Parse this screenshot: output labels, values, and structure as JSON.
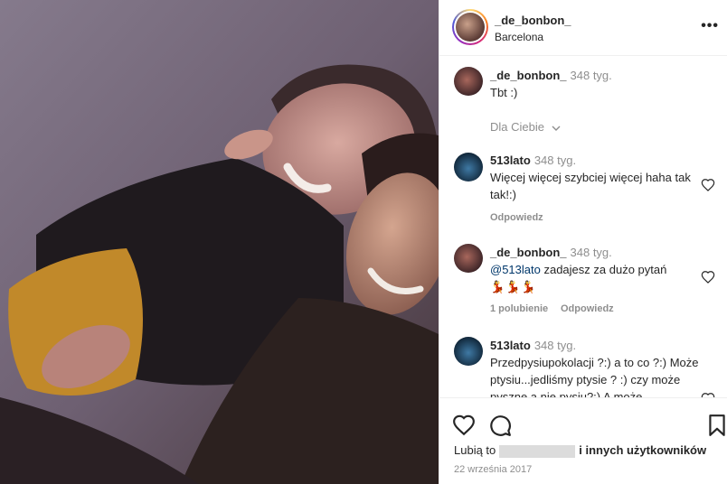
{
  "post": {
    "username": "_de_bonbon_",
    "location": "Barcelona",
    "more_label": "•••"
  },
  "comments": {
    "caption": {
      "user": "_de_bonbon_",
      "time": "348 tyg.",
      "text": "Tbt :)"
    },
    "for_you": "Dla Ciebie",
    "items": [
      {
        "user": "513lato",
        "time": "348 tyg.",
        "text": "Więcej więcej szybciej więcej haha tak tak!:)",
        "meta_reply": "Odpowiedz"
      },
      {
        "user": "_de_bonbon_",
        "time": "348 tyg.",
        "mention": "@513lato",
        "text": " zadajesz za dużo pytań",
        "emoji": "💃💃💃",
        "meta_likes": "1 polubienie",
        "meta_reply": "Odpowiedz"
      },
      {
        "user": "513lato",
        "time": "348 tyg.",
        "text": "Przedpysiupokolacji ?:) a to co ?:) Może ptysiu...jedliśmy ptysie ? :) czy może pyszne a nie pysiu?:) A może"
      }
    ]
  },
  "footer": {
    "likes_prefix": "Lubią to",
    "likes_suffix": "i innych użytkowników",
    "date": "22 września 2017"
  },
  "icons": {
    "like": "heart-icon",
    "comment": "comment-icon",
    "save": "bookmark-icon",
    "more": "more-icon"
  }
}
